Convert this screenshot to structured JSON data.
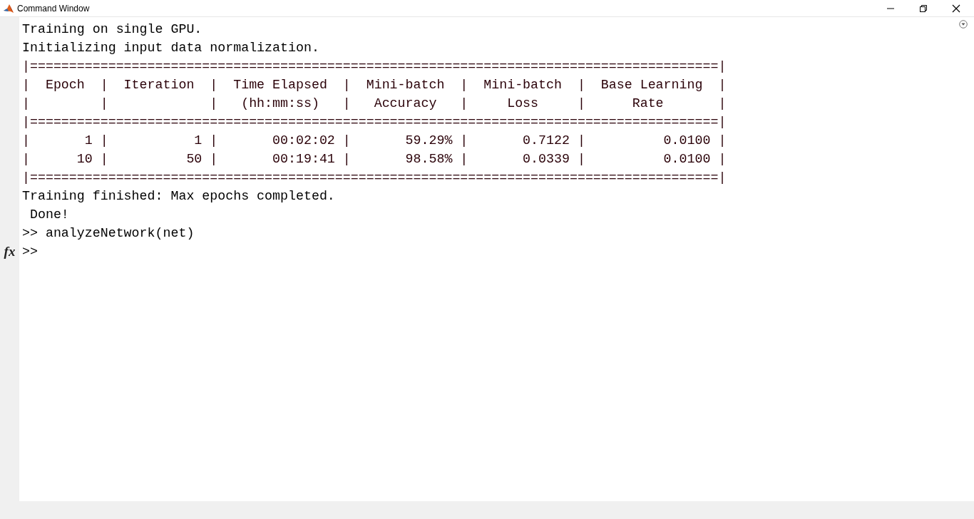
{
  "window": {
    "title": "Command Window"
  },
  "console": {
    "lines": [
      {
        "kind": "text",
        "text": "Training on single GPU."
      },
      {
        "kind": "text",
        "text": "Initializing input data normalization."
      },
      {
        "kind": "table",
        "text": "|========================================================================================|"
      },
      {
        "kind": "table",
        "text": "|  Epoch  |  Iteration  |  Time Elapsed  |  Mini-batch  |  Mini-batch  |  Base Learning  |"
      },
      {
        "kind": "table",
        "text": "|         |             |   (hh:mm:ss)   |   Accuracy   |     Loss     |      Rate       |"
      },
      {
        "kind": "table",
        "text": "|========================================================================================|"
      },
      {
        "kind": "table",
        "text": "|       1 |           1 |       00:02:02 |       59.29% |       0.7122 |          0.0100 |"
      },
      {
        "kind": "table",
        "text": "|      10 |          50 |       00:19:41 |       98.58% |       0.0339 |          0.0100 |"
      },
      {
        "kind": "table",
        "text": "|========================================================================================|"
      },
      {
        "kind": "text",
        "text": "Training finished: Max epochs completed."
      },
      {
        "kind": "text",
        "text": " Done!"
      },
      {
        "kind": "command",
        "text": ">> analyzeNetwork(net)"
      },
      {
        "kind": "prompt",
        "text": ">>",
        "gutter_icon": "fx"
      }
    ]
  }
}
